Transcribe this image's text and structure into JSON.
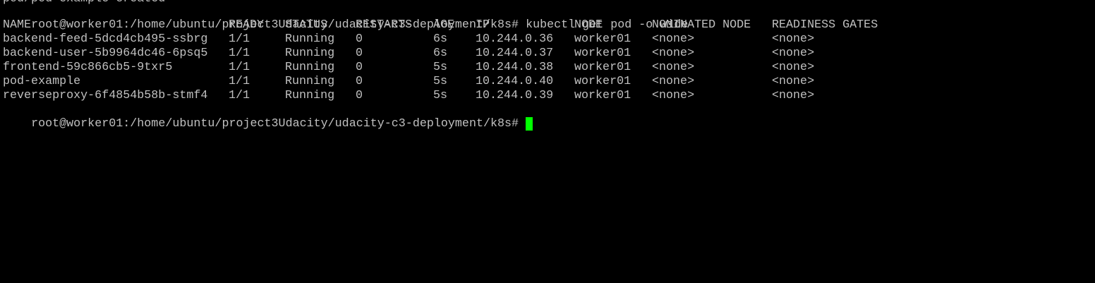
{
  "terminal": {
    "previous_output": "pod/pod-example created",
    "prompt": "root@worker01:/home/ubuntu/project3Udacity/udacity-c3-deployment/k8s#",
    "command": "kubectl get pod -o wide",
    "cursor_color": "#00ff00",
    "text_color": "#c0c0c0",
    "background_color": "#000000"
  },
  "table": {
    "headers": {
      "name": "NAME",
      "ready": "READY",
      "status": "STATUS",
      "restarts": "RESTARTS",
      "age": "AGE",
      "ip": "IP",
      "node": "NODE",
      "nominated": "NOMINATED NODE",
      "readiness": "READINESS GATES"
    },
    "rows": [
      {
        "name": "backend-feed-5dcd4cb495-ssbrg",
        "ready": "1/1",
        "status": "Running",
        "restarts": "0",
        "age": "6s",
        "ip": "10.244.0.36",
        "node": "worker01",
        "nominated": "<none>",
        "readiness": "<none>"
      },
      {
        "name": "backend-user-5b9964dc46-6psq5",
        "ready": "1/1",
        "status": "Running",
        "restarts": "0",
        "age": "6s",
        "ip": "10.244.0.37",
        "node": "worker01",
        "nominated": "<none>",
        "readiness": "<none>"
      },
      {
        "name": "frontend-59c866cb5-9txr5",
        "ready": "1/1",
        "status": "Running",
        "restarts": "0",
        "age": "5s",
        "ip": "10.244.0.38",
        "node": "worker01",
        "nominated": "<none>",
        "readiness": "<none>"
      },
      {
        "name": "pod-example",
        "ready": "1/1",
        "status": "Running",
        "restarts": "0",
        "age": "5s",
        "ip": "10.244.0.40",
        "node": "worker01",
        "nominated": "<none>",
        "readiness": "<none>"
      },
      {
        "name": "reverseproxy-6f4854b58b-stmf4",
        "ready": "1/1",
        "status": "Running",
        "restarts": "0",
        "age": "5s",
        "ip": "10.244.0.39",
        "node": "worker01",
        "nominated": "<none>",
        "readiness": "<none>"
      }
    ]
  }
}
